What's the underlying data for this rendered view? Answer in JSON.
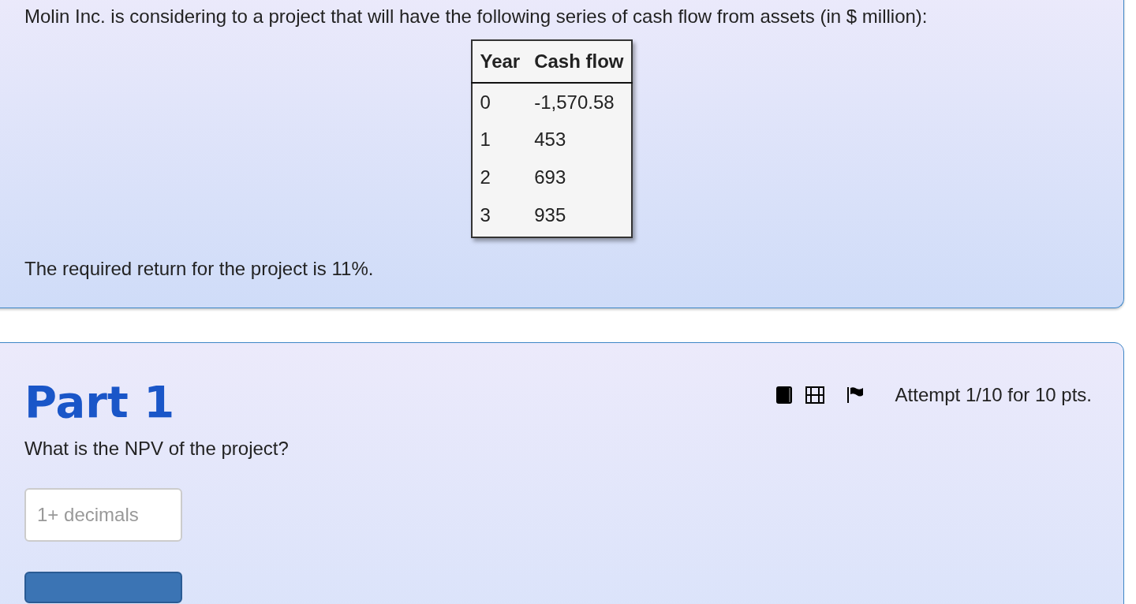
{
  "problem": {
    "intro": "Molin Inc. is considering to a project that will have the following series of cash flow from assets (in $ million):",
    "table": {
      "columns": [
        "Year",
        "Cash flow"
      ],
      "rows": [
        [
          "0",
          "-1,570.58"
        ],
        [
          "1",
          "453"
        ],
        [
          "2",
          "693"
        ],
        [
          "3",
          "935"
        ]
      ]
    },
    "note": "The required return for the project is 11%."
  },
  "part": {
    "title": "Part 1",
    "attempt": "Attempt 1/10 for 10 pts.",
    "question": "What is the NPV of the project?",
    "answer": {
      "placeholder": "1+ decimals"
    }
  }
}
